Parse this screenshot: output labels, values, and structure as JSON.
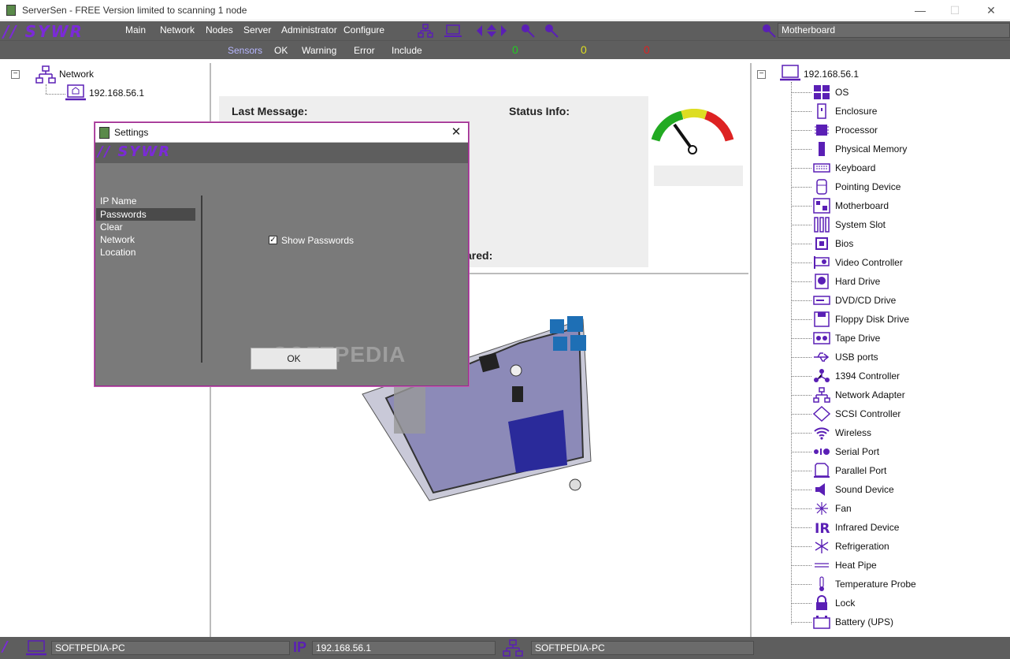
{
  "window": {
    "title": "ServerSen - FREE Version limited to scanning 1 node",
    "minimize_icon": "minimize-icon",
    "maximize_icon": "maximize-icon",
    "close_icon": "close-icon"
  },
  "menu": {
    "logo_text": "SYWR",
    "items": [
      "Main",
      "Network",
      "Nodes",
      "Server",
      "Administrator",
      "Configure"
    ],
    "search_value": "Motherboard"
  },
  "filters": {
    "items": [
      "Sensors",
      "OK",
      "Warning",
      "Error",
      "Include"
    ],
    "counts": [
      {
        "value": "0",
        "color": "#22cc22"
      },
      {
        "value": "0",
        "color": "#dddd22"
      },
      {
        "value": "0",
        "color": "#dd2222"
      }
    ]
  },
  "left_tree": {
    "root_label": "Network",
    "child_label": "192.168.56.1"
  },
  "info": {
    "last_message_label": "Last Message:",
    "status_info_label": "Status Info:",
    "partial_label": "ared:"
  },
  "gauge": {
    "colors": [
      "#22aa22",
      "#dddd22",
      "#dd2222"
    ]
  },
  "right_tree": {
    "root_label": "192.168.56.1",
    "items": [
      {
        "label": "OS",
        "icon": "windows-icon"
      },
      {
        "label": "Enclosure",
        "icon": "enclosure-icon"
      },
      {
        "label": "Processor",
        "icon": "processor-icon"
      },
      {
        "label": "Physical Memory",
        "icon": "memory-icon"
      },
      {
        "label": "Keyboard",
        "icon": "keyboard-icon"
      },
      {
        "label": "Pointing Device",
        "icon": "mouse-icon"
      },
      {
        "label": "Motherboard",
        "icon": "motherboard-icon"
      },
      {
        "label": "System Slot",
        "icon": "slot-icon"
      },
      {
        "label": "Bios",
        "icon": "bios-icon"
      },
      {
        "label": "Video Controller",
        "icon": "video-icon"
      },
      {
        "label": "Hard Drive",
        "icon": "harddrive-icon"
      },
      {
        "label": "DVD/CD Drive",
        "icon": "dvd-icon"
      },
      {
        "label": "Floppy Disk Drive",
        "icon": "floppy-icon"
      },
      {
        "label": "Tape Drive",
        "icon": "tape-icon"
      },
      {
        "label": "USB ports",
        "icon": "usb-icon"
      },
      {
        "label": "1394 Controller",
        "icon": "firewire-icon"
      },
      {
        "label": "Network Adapter",
        "icon": "network-icon"
      },
      {
        "label": "SCSI Controller",
        "icon": "scsi-icon"
      },
      {
        "label": "Wireless",
        "icon": "wireless-icon"
      },
      {
        "label": "Serial Port",
        "icon": "serial-icon"
      },
      {
        "label": "Parallel Port",
        "icon": "parallel-icon"
      },
      {
        "label": "Sound Device",
        "icon": "speaker-icon"
      },
      {
        "label": "Fan",
        "icon": "fan-icon"
      },
      {
        "label": "Infrared Device",
        "icon": "infrared-icon"
      },
      {
        "label": "Refrigeration",
        "icon": "snowflake-icon"
      },
      {
        "label": "Heat Pipe",
        "icon": "heatpipe-icon"
      },
      {
        "label": "Temperature Probe",
        "icon": "thermometer-icon"
      },
      {
        "label": "Lock",
        "icon": "lock-icon"
      },
      {
        "label": "Battery (UPS)",
        "icon": "battery-icon"
      }
    ]
  },
  "status_bar": {
    "computer_name": "SOFTPEDIA-PC",
    "ip_label": "IP",
    "ip_value": "192.168.56.1",
    "network_name": "SOFTPEDIA-PC"
  },
  "dialog": {
    "title": "Settings",
    "logo_text": "SYWR",
    "menu_items": [
      "IP Name",
      "Passwords",
      "Clear",
      "Network",
      "Location"
    ],
    "selected_item": "Passwords",
    "checkbox_label": "Show Passwords",
    "checkbox_checked": true,
    "ok_label": "OK",
    "watermark": "SOFTPEDIA"
  }
}
